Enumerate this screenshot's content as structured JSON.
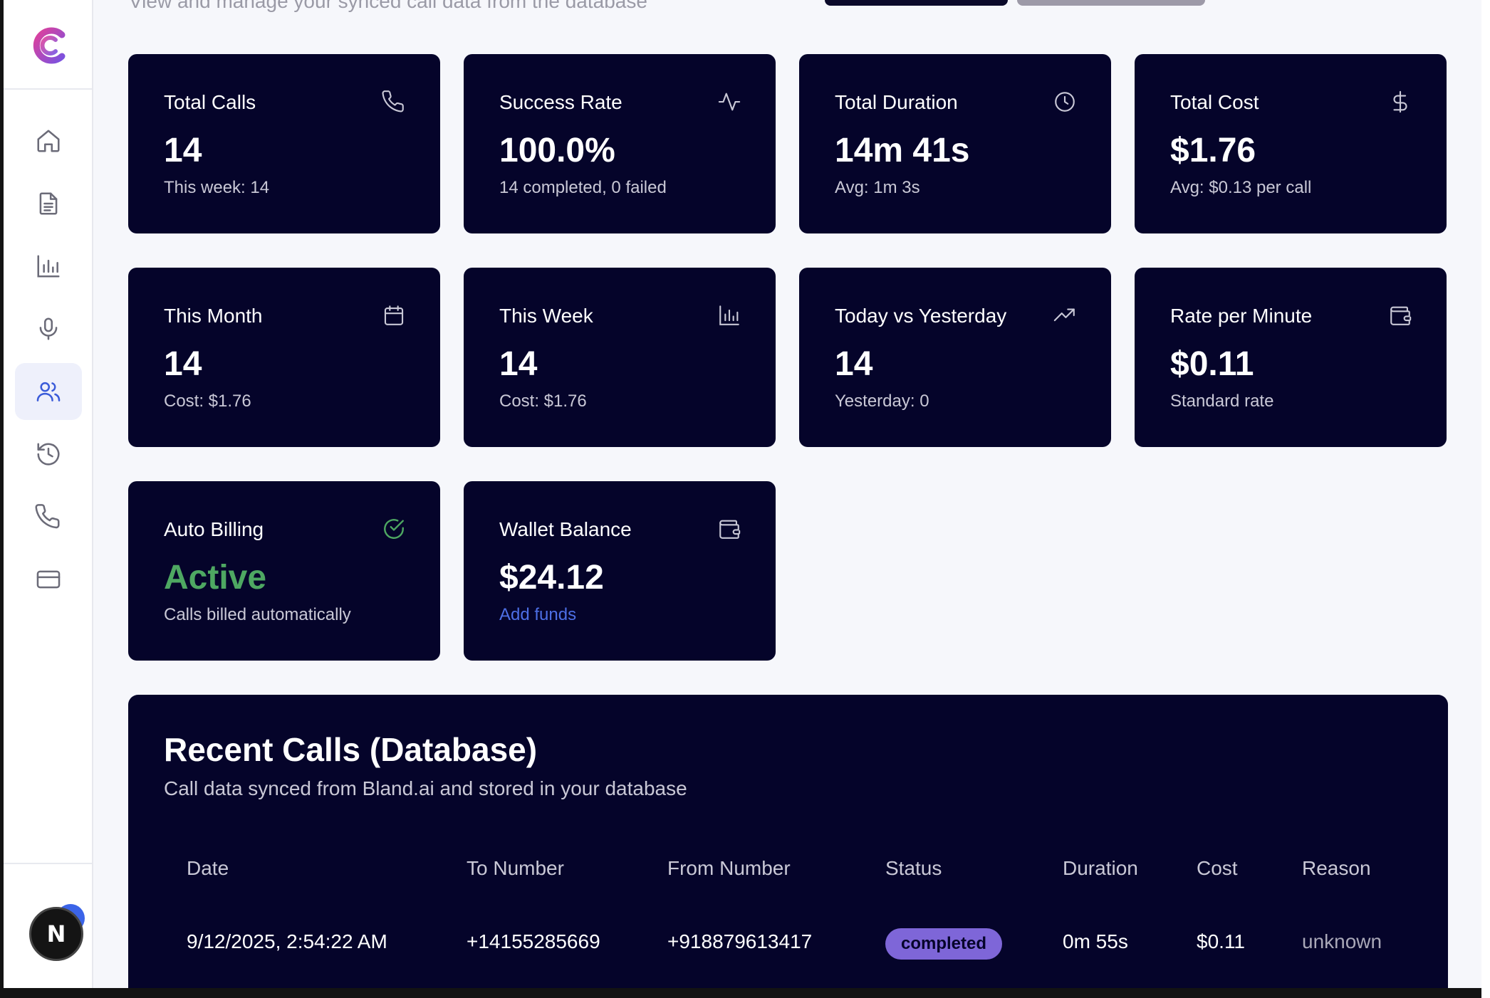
{
  "header": {
    "subtitle": "View and manage your synced call data from the database"
  },
  "sidebar": {
    "items": [
      {
        "name": "home",
        "icon": "home-icon"
      },
      {
        "name": "documents",
        "icon": "document-icon"
      },
      {
        "name": "analytics",
        "icon": "bar-chart-icon"
      },
      {
        "name": "voice",
        "icon": "microphone-icon"
      },
      {
        "name": "users",
        "icon": "users-icon",
        "active": true
      },
      {
        "name": "history",
        "icon": "history-icon"
      },
      {
        "name": "calls",
        "icon": "phone-icon"
      },
      {
        "name": "billing",
        "icon": "credit-card-icon"
      }
    ],
    "avatar_initial": "N"
  },
  "stats": {
    "total_calls": {
      "title": "Total Calls",
      "value": "14",
      "sub": "This week: 14",
      "icon": "phone-icon"
    },
    "success_rate": {
      "title": "Success Rate",
      "value": "100.0%",
      "sub": "14 completed, 0 failed",
      "icon": "activity-icon"
    },
    "total_duration": {
      "title": "Total Duration",
      "value": "14m 41s",
      "sub": "Avg: 1m 3s",
      "icon": "clock-icon"
    },
    "total_cost": {
      "title": "Total Cost",
      "value": "$1.76",
      "sub": "Avg: $0.13 per call",
      "icon": "dollar-icon"
    },
    "this_month": {
      "title": "This Month",
      "value": "14",
      "sub": "Cost: $1.76",
      "icon": "calendar-icon"
    },
    "this_week": {
      "title": "This Week",
      "value": "14",
      "sub": "Cost: $1.76",
      "icon": "bar-chart-icon"
    },
    "today_vs_yesterday": {
      "title": "Today vs Yesterday",
      "value": "14",
      "sub": "Yesterday: 0",
      "icon": "trending-up-icon"
    },
    "rate_per_minute": {
      "title": "Rate per Minute",
      "value": "$0.11",
      "sub": "Standard rate",
      "icon": "wallet-icon"
    },
    "auto_billing": {
      "title": "Auto Billing",
      "value": "Active",
      "sub": "Calls billed automatically",
      "icon": "check-circle-icon"
    },
    "wallet_balance": {
      "title": "Wallet Balance",
      "value": "$24.12",
      "sub": "Add funds",
      "icon": "wallet-icon"
    }
  },
  "colors": {
    "card_bg": "#05042a",
    "page_bg": "#f6f7fb",
    "active_green": "#4ea862",
    "link_blue": "#4d6fe6",
    "badge_purple": "#7e66d8"
  },
  "recent_calls": {
    "title": "Recent Calls (Database)",
    "subtitle": "Call data synced from Bland.ai and stored in your database",
    "columns": [
      "Date",
      "To Number",
      "From Number",
      "Status",
      "Duration",
      "Cost",
      "Reason"
    ],
    "rows": [
      {
        "date": "9/12/2025, 2:54:22 AM",
        "to": "+14155285669",
        "from": "+918879613417",
        "status": "completed",
        "duration": "0m 55s",
        "cost": "$0.11",
        "reason": "unknown"
      }
    ]
  }
}
